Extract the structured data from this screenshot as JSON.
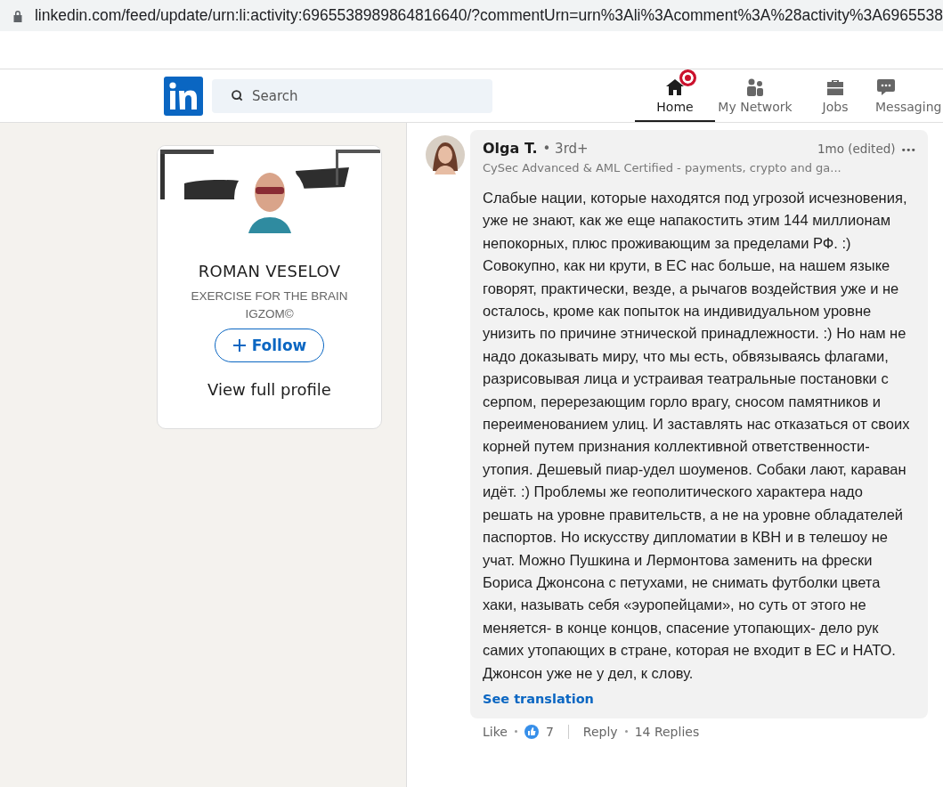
{
  "address_bar": {
    "url": "linkedin.com/feed/update/urn:li:activity:6965538989864816640/?commentUrn=urn%3Ali%3Acomment%3A%28activity%3A6965538"
  },
  "nav": {
    "search": {
      "placeholder": "Search"
    },
    "items": [
      {
        "kind": "home",
        "label": "Home",
        "selected": true,
        "badge": true
      },
      {
        "kind": "network",
        "label": "My Network",
        "selected": false,
        "badge": false
      },
      {
        "kind": "jobs",
        "label": "Jobs",
        "selected": false,
        "badge": false
      },
      {
        "kind": "messaging",
        "label": "Messaging",
        "selected": false,
        "badge": false
      }
    ]
  },
  "profile_card": {
    "name": "ROMAN VESELOV",
    "headline": "EXERCISE FOR THE BRAIN IGZOM©",
    "follow": "Follow",
    "view_profile": "View full profile"
  },
  "comment": {
    "author": "Olga T.",
    "degree": "• 3rd+",
    "time": "1mo (edited)",
    "more": "•••",
    "subtitle": "CySec Advanced & AML Certified - payments, crypto and ga...",
    "text": "Слабые нации, которые находятся под угрозой исчезновения, уже не знают, как же еще напакостить этим 144 миллионам непокорных, плюс проживающим за пределами РФ. :) Совокупно, как ни крути, в ЕС нас больше, на нашем языке говорят, практически, везде, а рычагов воздействия уже и не осталось, кроме как попыток на индивидуальном уровне унизить по причине этнической принадлежности. :) Но нам не надо доказывать миру, что мы есть, обвязываясь флагами, разрисовывая лица и устраивая театральные постановки с серпом, перерезающим горло врагу, сносом памятников и переименованием улиц. И заставлять нас отказаться от своих корней путем признания коллективной ответственности- утопия. Дешевый пиар-удел шоуменов. Собаки лают, караван идёт. :) Проблемы же геополитического характера надо решать на уровне правительств, а не на уровне обладателей паспортов. Но искусству дипломатии в КВН и в телешоу не учат. Можно Пушкина и Лермонтова заменить на фрески Бориса Джонсона с петухами, не снимать футболки цвета хаки, называть себя «эуропейцами», но суть от этого не меняется- в конце концов, спасение утопающих- дело рук самих утопающих в стране, которая не входит в ЕС и НАТО. Джонсон уже не у дел, к слову.",
    "see_translation": "See translation",
    "actions": {
      "like": "Like",
      "reactions": "7",
      "reply": "Reply",
      "replies": "14 Replies"
    }
  }
}
